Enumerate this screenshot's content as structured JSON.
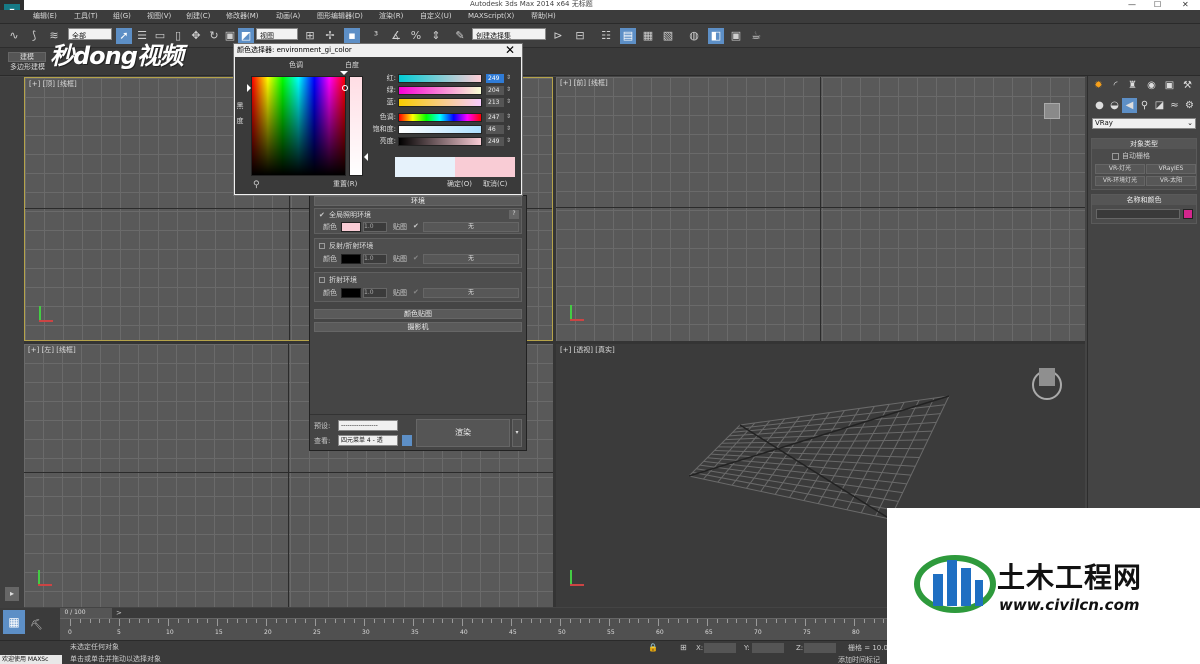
{
  "window": {
    "title": "Autodesk 3ds Max  2014 x64      无标题",
    "controls": [
      "—",
      "☐",
      "✕"
    ]
  },
  "menu": [
    "编辑(E)",
    "工具(T)",
    "组(G)",
    "视图(V)",
    "创建(C)",
    "修改器(M)",
    "动画(A)",
    "图形编辑器(D)",
    "渲染(R)",
    "自定义(U)",
    "MAXScript(X)",
    "帮助(H)"
  ],
  "toolbar": {
    "filter_select": "全部",
    "view_select": "视图",
    "named_selection": "创建选择集"
  },
  "ribbon": {
    "tab": "建模",
    "subtab": "多边形建模"
  },
  "watermark_top": "秒dong视频",
  "viewports": {
    "top_left": "[+] [顶] [线框]",
    "top_right": "[+] [前] [线框]",
    "bottom_left": "[+] [左] [线框]",
    "bottom_right": "[+] [透视] [真实]"
  },
  "command_panel": {
    "renderer": "VRay",
    "object_type_header": "对象类型",
    "auto_grid": "自动栅格",
    "buttons": [
      "VR-灯光",
      "VRayIES",
      "VR-环境灯光",
      "VR-太阳"
    ],
    "name_color_header": "名称和颜色",
    "object_color": "#d4258c"
  },
  "render_dialog": {
    "env_header": "环境",
    "gi_env_label": "全局照明环境",
    "color_label": "颜色",
    "gi_multiplier": "1.0",
    "map_label": "贴图",
    "none_label": "无",
    "reflect_env_label": "反射/折射环境",
    "reflect_multiplier": "1.0",
    "refract_env_label": "折射环境",
    "refract_multiplier": "1.0",
    "color_map_header": "颜色贴图",
    "camera_header": "摄影机",
    "preset_label": "预设:",
    "preset_value": "-----------------",
    "view_label": "查看:",
    "view_value": "四元菜单 4 - 透",
    "render_button": "渲染",
    "gi_color": "#f9ccd5"
  },
  "color_dialog": {
    "title": "颜色选择器: environment_gi_color",
    "hue_label": "色调",
    "whiteness_label": "白度",
    "blackness_label": "黑度",
    "rows": [
      {
        "label": "红:",
        "value": "249"
      },
      {
        "label": "绿:",
        "value": "204"
      },
      {
        "label": "蓝:",
        "value": "213"
      },
      {
        "label": "色调:",
        "value": "247"
      },
      {
        "label": "饱和度:",
        "value": "46"
      },
      {
        "label": "亮度:",
        "value": "249"
      }
    ],
    "reset_button": "重置(R)",
    "ok_button": "确定(O)",
    "cancel_button": "取消(C)",
    "old_color": "#e6f2fb",
    "new_color": "#f9ccd5"
  },
  "timeline": {
    "frame_counter": "0 / 100",
    "ticks": [
      "0",
      "5",
      "10",
      "15",
      "20",
      "25",
      "30",
      "35",
      "40",
      "45",
      "50",
      "55",
      "60",
      "65",
      "70",
      "75",
      "80",
      "85"
    ]
  },
  "status": {
    "welcome": "欢迎使用 MAXSc",
    "line1": "未选定任何对象",
    "line2": "单击或单击并拖动以选择对象",
    "x_label": "X:",
    "y_label": "Y:",
    "z_label": "Z:",
    "grid_label": "栅格 = 10.0",
    "add_time_tag": "添加时间标记"
  },
  "watermark": {
    "cn": "土木工程网",
    "url": "www.civilcn.com"
  }
}
